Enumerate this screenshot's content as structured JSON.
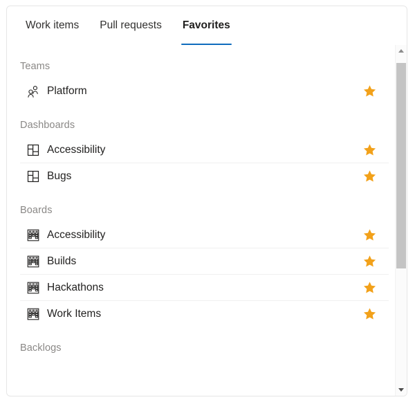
{
  "tabs": [
    {
      "label": "Work items",
      "active": false
    },
    {
      "label": "Pull requests",
      "active": false
    },
    {
      "label": "Favorites",
      "active": true
    }
  ],
  "colors": {
    "accent": "#0f6cbd",
    "star": "#f2a11a",
    "section_header": "#8a8886",
    "text": "#201f1e",
    "divider": "#f0f0f0",
    "scrollbar_thumb": "#c4c4c4"
  },
  "sections": [
    {
      "title": "Teams",
      "items": [
        {
          "label": "Platform",
          "icon": "people-icon",
          "favorited": true
        }
      ]
    },
    {
      "title": "Dashboards",
      "items": [
        {
          "label": "Accessibility",
          "icon": "dashboard-icon",
          "favorited": true
        },
        {
          "label": "Bugs",
          "icon": "dashboard-icon",
          "favorited": true
        }
      ]
    },
    {
      "title": "Boards",
      "items": [
        {
          "label": "Accessibility",
          "icon": "board-icon",
          "favorited": true
        },
        {
          "label": "Builds",
          "icon": "board-icon",
          "favorited": true
        },
        {
          "label": "Hackathons",
          "icon": "board-icon",
          "favorited": true
        },
        {
          "label": "Work Items",
          "icon": "board-icon",
          "favorited": true
        }
      ]
    },
    {
      "title": "Backlogs",
      "items": []
    }
  ],
  "scrollbar": {
    "up_icon": "scroll-up-arrow-icon",
    "down_icon": "scroll-down-arrow-icon"
  }
}
